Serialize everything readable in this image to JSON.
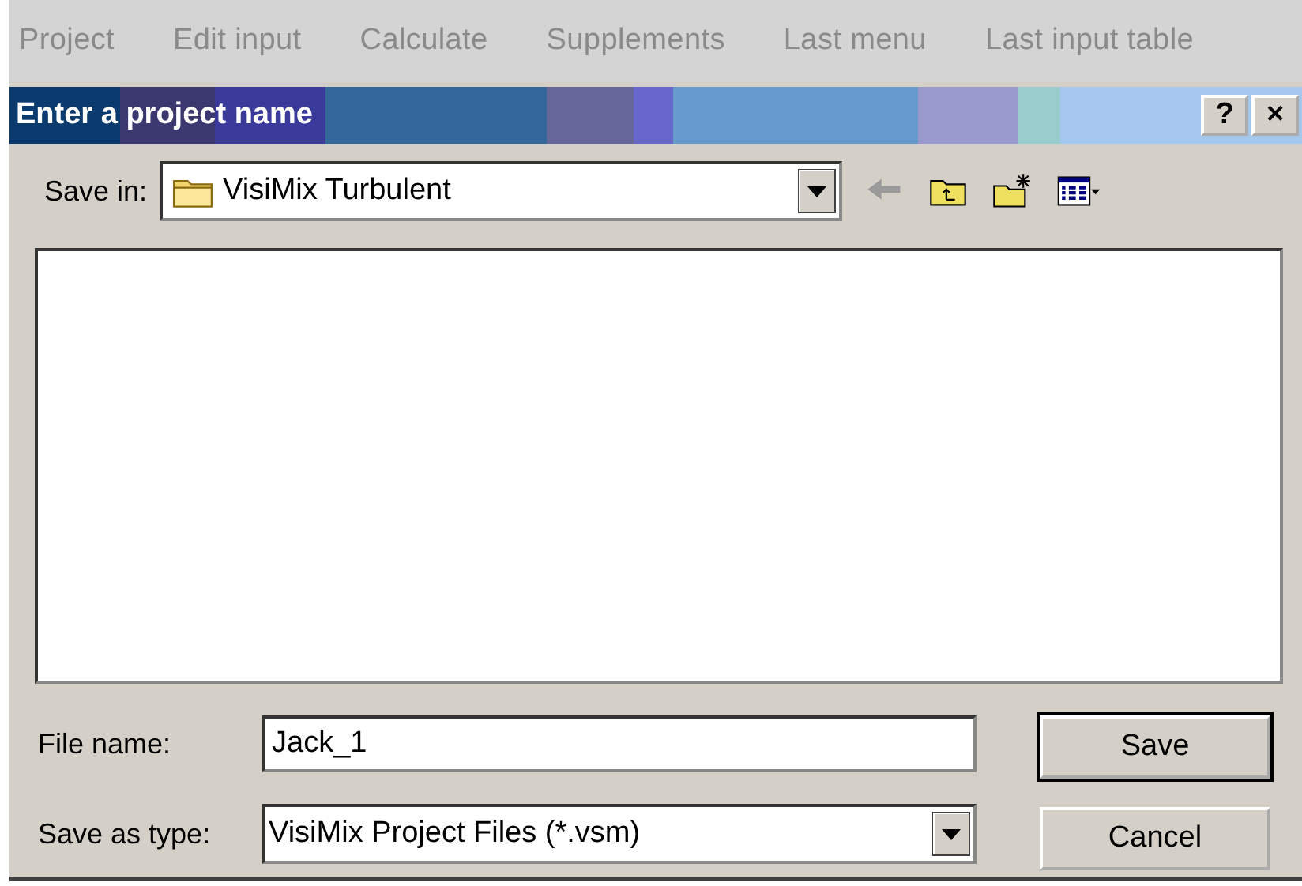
{
  "menu": [
    {
      "label": "Project",
      "disabled": true
    },
    {
      "label": "Edit input",
      "disabled": true
    },
    {
      "label": "Calculate",
      "disabled": true
    },
    {
      "label": "Supplements",
      "disabled": true
    },
    {
      "label": "Last menu",
      "disabled": true
    },
    {
      "label": "Last input table",
      "disabled": true
    }
  ],
  "dialog": {
    "title": "Enter a project name",
    "title_buttons": [
      "?",
      "×"
    ],
    "save_in": {
      "label": "Save in:",
      "value": "VisiMix Turbulent"
    },
    "file_name": {
      "label": "File name:",
      "value": "Jack_1"
    },
    "save_as_type": {
      "label": "Save as type:",
      "value": "VisiMix Project Files (*.vsm)"
    },
    "buttons": [
      {
        "label": "Save",
        "default": true
      },
      {
        "label": "Cancel",
        "default": false
      }
    ]
  }
}
